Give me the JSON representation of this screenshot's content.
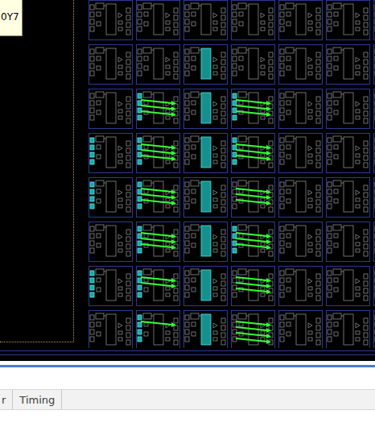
{
  "tooltip": {
    "text": "0Y7"
  },
  "device": {
    "rows": [
      {
        "tiles": [
          {
            "site_selected": false,
            "pins_selected": false,
            "nets": 0
          },
          {
            "site_selected": false,
            "pins_selected": false,
            "nets": 0
          },
          {
            "site_selected": false,
            "pins_selected": false,
            "nets": 0
          },
          {
            "site_selected": false,
            "pins_selected": false,
            "nets": 0
          },
          {
            "site_selected": false,
            "pins_selected": false,
            "nets": 0
          },
          {
            "site_selected": false,
            "pins_selected": false,
            "nets": 0
          },
          {
            "site_selected": false,
            "pins_selected": false,
            "nets": 0
          }
        ]
      },
      {
        "tiles": [
          {
            "site_selected": false,
            "pins_selected": false,
            "nets": 0
          },
          {
            "site_selected": false,
            "pins_selected": false,
            "nets": 0
          },
          {
            "site_selected": true,
            "pins_selected": false,
            "nets": 0
          },
          {
            "site_selected": false,
            "pins_selected": false,
            "nets": 0
          },
          {
            "site_selected": false,
            "pins_selected": false,
            "nets": 0
          },
          {
            "site_selected": false,
            "pins_selected": false,
            "nets": 0
          },
          {
            "site_selected": false,
            "pins_selected": false,
            "nets": 0
          }
        ]
      },
      {
        "tiles": [
          {
            "site_selected": false,
            "pins_selected": false,
            "nets": 0
          },
          {
            "site_selected": false,
            "pins_selected": true,
            "nets": 3
          },
          {
            "site_selected": true,
            "pins_selected": false,
            "nets": 0
          },
          {
            "site_selected": false,
            "pins_selected": true,
            "nets": 3
          },
          {
            "site_selected": false,
            "pins_selected": false,
            "nets": 0
          },
          {
            "site_selected": false,
            "pins_selected": false,
            "nets": 0
          },
          {
            "site_selected": false,
            "pins_selected": false,
            "nets": 0
          }
        ]
      },
      {
        "tiles": [
          {
            "site_selected": false,
            "pins_selected": true,
            "nets": 0
          },
          {
            "site_selected": false,
            "pins_selected": true,
            "nets": 3
          },
          {
            "site_selected": true,
            "pins_selected": false,
            "nets": 0
          },
          {
            "site_selected": false,
            "pins_selected": true,
            "nets": 3
          },
          {
            "site_selected": false,
            "pins_selected": false,
            "nets": 0
          },
          {
            "site_selected": false,
            "pins_selected": false,
            "nets": 0
          },
          {
            "site_selected": false,
            "pins_selected": false,
            "nets": 0
          }
        ]
      },
      {
        "tiles": [
          {
            "site_selected": false,
            "pins_selected": true,
            "nets": 0
          },
          {
            "site_selected": false,
            "pins_selected": true,
            "nets": 3
          },
          {
            "site_selected": true,
            "pins_selected": false,
            "nets": 0
          },
          {
            "site_selected": false,
            "pins_selected": false,
            "nets": 3
          },
          {
            "site_selected": false,
            "pins_selected": false,
            "nets": 0
          },
          {
            "site_selected": false,
            "pins_selected": false,
            "nets": 0
          },
          {
            "site_selected": false,
            "pins_selected": false,
            "nets": 0
          }
        ]
      },
      {
        "tiles": [
          {
            "site_selected": false,
            "pins_selected": false,
            "nets": 0
          },
          {
            "site_selected": false,
            "pins_selected": true,
            "nets": 3
          },
          {
            "site_selected": true,
            "pins_selected": false,
            "nets": 0
          },
          {
            "site_selected": false,
            "pins_selected": true,
            "nets": 3
          },
          {
            "site_selected": false,
            "pins_selected": false,
            "nets": 0
          },
          {
            "site_selected": false,
            "pins_selected": false,
            "nets": 0
          },
          {
            "site_selected": false,
            "pins_selected": false,
            "nets": 0
          }
        ]
      },
      {
        "tiles": [
          {
            "site_selected": false,
            "pins_selected": true,
            "nets": 0
          },
          {
            "site_selected": false,
            "pins_selected": true,
            "nets": 2
          },
          {
            "site_selected": true,
            "pins_selected": false,
            "nets": 0
          },
          {
            "site_selected": false,
            "pins_selected": false,
            "nets": 3
          },
          {
            "site_selected": false,
            "pins_selected": false,
            "nets": 0
          },
          {
            "site_selected": false,
            "pins_selected": false,
            "nets": 0
          },
          {
            "site_selected": false,
            "pins_selected": false,
            "nets": 0
          }
        ]
      },
      {
        "tiles": [
          {
            "site_selected": false,
            "pins_selected": false,
            "nets": 0
          },
          {
            "site_selected": false,
            "pins_selected": true,
            "nets": 1
          },
          {
            "site_selected": true,
            "pins_selected": false,
            "nets": 0
          },
          {
            "site_selected": false,
            "pins_selected": false,
            "nets": 4
          },
          {
            "site_selected": false,
            "pins_selected": false,
            "nets": 0
          },
          {
            "site_selected": false,
            "pins_selected": false,
            "nets": 0
          },
          {
            "site_selected": false,
            "pins_selected": false,
            "nets": 0
          }
        ]
      }
    ]
  },
  "tabs": [
    {
      "label": "r",
      "selected": false
    },
    {
      "label": "Timing",
      "selected": false
    }
  ]
}
